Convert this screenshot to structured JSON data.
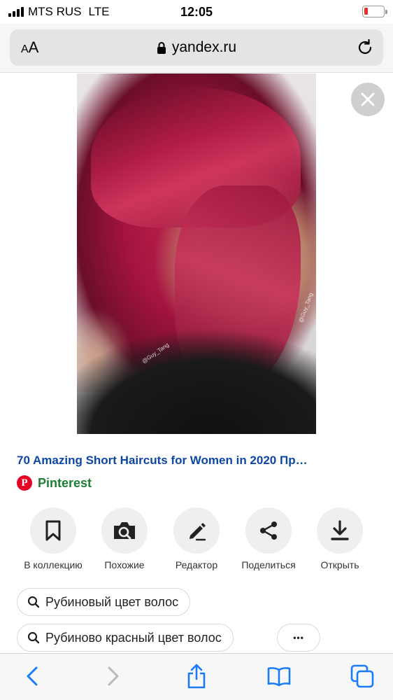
{
  "status_bar": {
    "carrier": "MTS RUS",
    "network": "LTE",
    "time": "12:05"
  },
  "address_bar": {
    "text_size_label_small": "A",
    "text_size_label_large": "A",
    "url": "yandex.ru"
  },
  "image": {
    "watermark_1": "@Guy_Tang",
    "watermark_2": "@Guy_Tang"
  },
  "result": {
    "title": "70 Amazing Short Haircuts for Women in 2020 Пр…",
    "source": "Pinterest",
    "source_logo_letter": "P"
  },
  "actions": [
    {
      "label": "В коллекцию",
      "icon": "bookmark-icon"
    },
    {
      "label": "Похожие",
      "icon": "camera-search-icon"
    },
    {
      "label": "Редактор",
      "icon": "pencil-icon"
    },
    {
      "label": "Поделиться",
      "icon": "share-icon"
    },
    {
      "label": "Открыть",
      "icon": "download-icon"
    }
  ],
  "related": {
    "chip_1": "Рубиновый цвет волос",
    "chip_2": "Рубиново красный цвет волос",
    "more_label": "•••"
  },
  "colors": {
    "link_blue": "#0d47a1",
    "source_green": "#1e7e34",
    "pinterest_red": "#e60023",
    "ios_blue": "#1a7cf5"
  }
}
